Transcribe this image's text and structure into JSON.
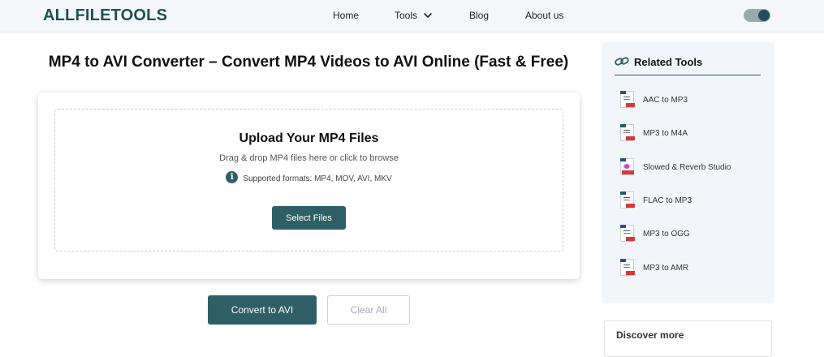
{
  "header": {
    "logo": "ALLFILETOOLS",
    "nav": {
      "home": "Home",
      "tools": "Tools",
      "blog": "Blog",
      "about": "About us"
    }
  },
  "main": {
    "title": "MP4 to AVI Converter – Convert MP4 Videos to AVI Online (Fast & Free)",
    "upload": {
      "title": "Upload Your MP4 Files",
      "subtitle": "Drag & drop MP4 files here or click to browse",
      "formats": "Supported formats: MP4, MOV, AVI, MKV",
      "select_label": "Select Files"
    },
    "convert_label": "Convert to AVI",
    "clear_label": "Clear All"
  },
  "sidebar": {
    "title": "Related Tools",
    "items": [
      {
        "label": "AAC to MP3"
      },
      {
        "label": "MP3 to M4A"
      },
      {
        "label": "Slowed & Reverb Studio"
      },
      {
        "label": "FLAC to MP3"
      },
      {
        "label": "MP3 to OGG"
      },
      {
        "label": "MP3 to AMR"
      }
    ],
    "discover": "Discover more"
  },
  "colors": {
    "brand": "#1f4f55",
    "accent": "#2f5f66",
    "badge_red": "#d6393a"
  }
}
